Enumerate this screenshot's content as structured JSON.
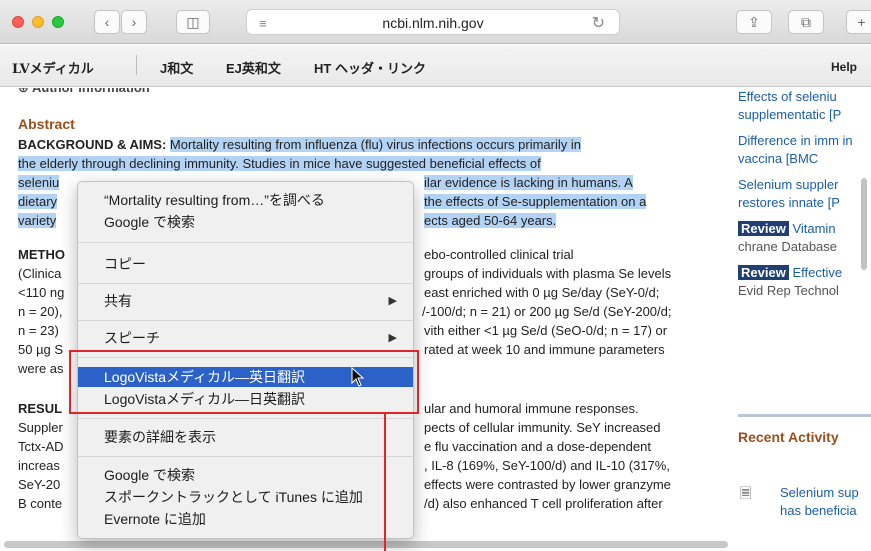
{
  "toolbar": {
    "url": "ncbi.nlm.nih.gov",
    "back_glyph": "‹",
    "forward_glyph": "›",
    "sidebar_glyph": "◫",
    "reader_glyph": "≡",
    "reload_glyph": "↻",
    "share_glyph": "⇪",
    "tabs_glyph": "⧉",
    "newtab_glyph": "+"
  },
  "bookmarks": {
    "items": [
      "LVメディカル",
      "J和文",
      "EJ英和文",
      "HT ヘッダ・リンク"
    ],
    "help": "Help"
  },
  "article": {
    "author_info": "⊕ Author information",
    "abstract_heading": "Abstract",
    "background_label": "BACKGROUND & AIMS:",
    "lines": [
      "Mortality resulting from influenza (flu) virus infections occurs primarily in",
      "the elderly through declining immunity. Studies in mice have suggested beneficial effects of",
      "seleniu",
      "ilar evidence is lacking in humans. A",
      "dietary",
      "the effects of Se-supplementation on a",
      "variety",
      "ects aged 50-64 years."
    ],
    "methods_label": "METHO",
    "methods_lines": [
      "ebo-controlled clinical trial",
      "(Clinica",
      "groups of individuals with plasma Se levels",
      "<110 ng",
      "east enriched with 0 µg Se/day (SeY-0/d;",
      "n = 20),",
      "/-100/d; n = 21) or 200 µg Se/d (SeY-200/d;",
      "n = 23)",
      "vith either <1 µg Se/d (SeO-0/d; n = 17) or",
      "50 µg S",
      "rated at week 10 and immune parameters",
      "were as"
    ],
    "results_label": "RESUL",
    "results_lines": [
      "ular and humoral immune responses.",
      "Suppler",
      "pects of cellular immunity. SeY increased",
      "Tctx-AD",
      "e flu vaccination and a dose-dependent",
      "increas",
      ", IL-8 (169%, SeY-100/d) and IL-10 (317%,",
      "SeY-20",
      "effects were contrasted by lower granzyme",
      "B conte",
      "/d) also enhanced T cell proliferation after"
    ]
  },
  "sidebar": {
    "items": [
      {
        "text": "Effects of seleniu supplementatic [P"
      },
      {
        "text": "Difference in imm in vaccina [BMC"
      },
      {
        "text": "Selenium suppler restores innate [P"
      },
      {
        "badge": "Review",
        "text": "Vitamin",
        "source": "chrane Database"
      },
      {
        "badge": "Review",
        "text": "Effective",
        "source": "Evid Rep Technol"
      }
    ],
    "recent_heading": "Recent Activity",
    "recent_item": "Selenium sup has beneficia",
    "doc_icon": "🗏"
  },
  "context_menu": {
    "lookup": "“Mortality resulting from…”を調べる",
    "google_search_top": "Google で検索",
    "copy": "コピー",
    "share": "共有",
    "speech": "スピーチ",
    "translate_ej": "LogoVistaメディカル―英日翻訳",
    "translate_je": "LogoVistaメディカル―日英翻訳",
    "inspect": "要素の詳細を表示",
    "google_search": "Google で検索",
    "add_itunes": "スポークントラックとして iTunes に追加",
    "evernote": "Evernote に追加",
    "submenu_arrow": "▶"
  },
  "colors": {
    "highlight": "#b3d3f5",
    "menu_selected": "#2c62c8",
    "callout": "#e3242b",
    "heading_brown": "#9b4f1a",
    "link_blue": "#1b5ea8"
  }
}
